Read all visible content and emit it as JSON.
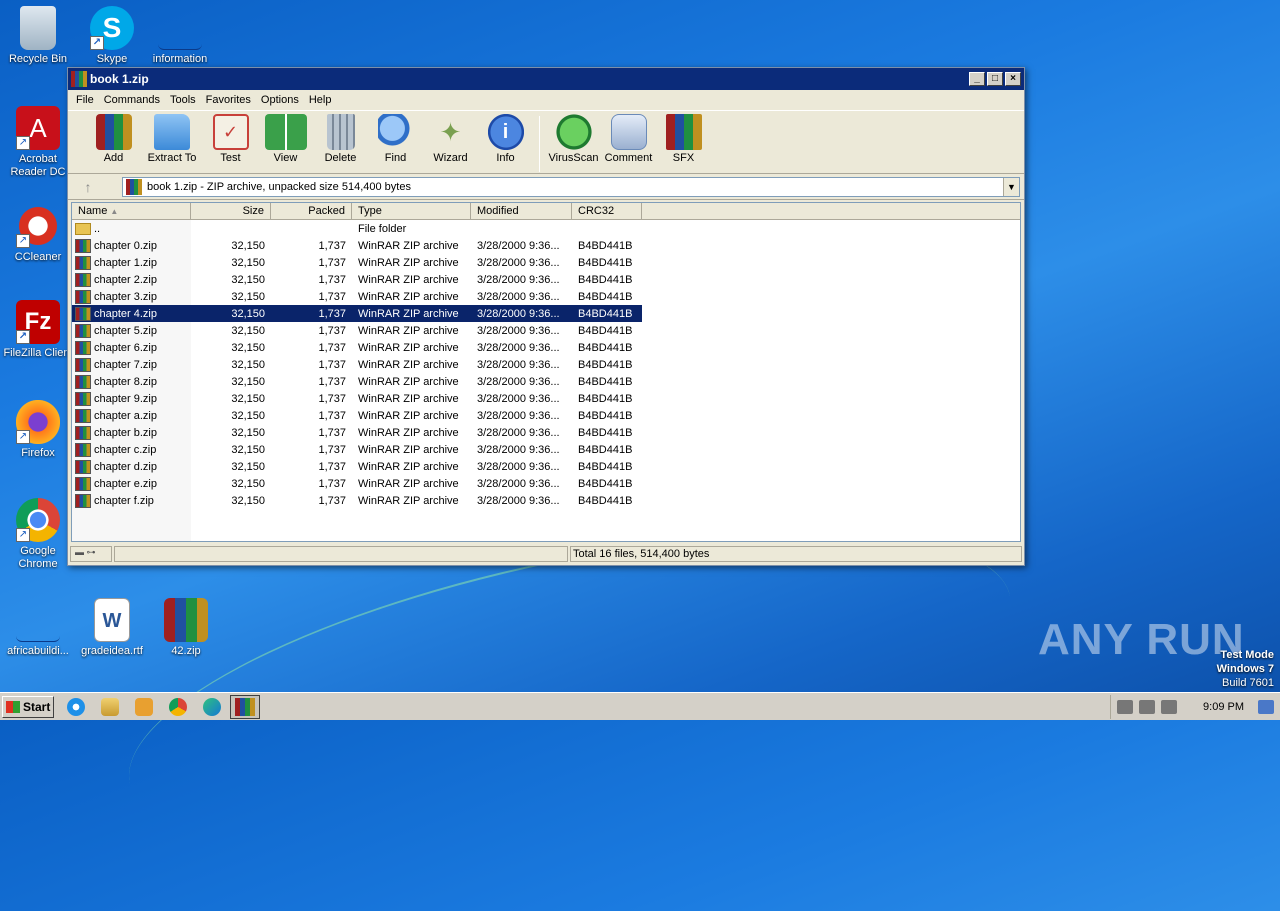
{
  "desktop": {
    "icons": [
      {
        "label": "Recycle Bin",
        "icon": "recycle-bin-icon"
      },
      {
        "label": "Skype",
        "icon": "skype-icon"
      },
      {
        "label": "information",
        "icon": "document-icon"
      },
      {
        "label": "Acrobat Reader DC",
        "icon": "acrobat-icon"
      },
      {
        "label": "CCleaner",
        "icon": "ccleaner-icon"
      },
      {
        "label": "FileZilla Client",
        "icon": "filezilla-icon"
      },
      {
        "label": "Firefox",
        "icon": "firefox-icon"
      },
      {
        "label": "Google Chrome",
        "icon": "chrome-icon"
      },
      {
        "label": "africabuildi...",
        "icon": "document-icon"
      },
      {
        "label": "gradeidea.rtf",
        "icon": "word-icon"
      },
      {
        "label": "42.zip",
        "icon": "winrar-icon"
      }
    ],
    "watermark": "ANY RUN",
    "test_mode": {
      "line1": "Test Mode",
      "line2": "Windows 7",
      "line3": "Build 7601"
    }
  },
  "window": {
    "title": "book 1.zip",
    "menu": [
      "File",
      "Commands",
      "Tools",
      "Favorites",
      "Options",
      "Help"
    ],
    "toolbar": [
      {
        "label": "Add",
        "icon": "add-icon",
        "color": "#b83a20"
      },
      {
        "label": "Extract To",
        "icon": "extract-folder-icon",
        "color": "#3c8ad8"
      },
      {
        "label": "Test",
        "icon": "test-checklist-icon",
        "color": "#c8403a"
      },
      {
        "label": "View",
        "icon": "view-book-icon",
        "color": "#3aa04a"
      },
      {
        "label": "Delete",
        "icon": "trash-icon",
        "color": "#8a98a8"
      },
      {
        "label": "Find",
        "icon": "magnifier-icon",
        "color": "#2f6fc8"
      },
      {
        "label": "Wizard",
        "icon": "wand-icon",
        "color": "#7aa050"
      },
      {
        "label": "Info",
        "icon": "info-icon",
        "color": "#2d62c8"
      },
      {
        "label": "VirusScan",
        "icon": "virus-scan-icon",
        "color": "#2ea040"
      },
      {
        "label": "Comment",
        "icon": "comment-icon",
        "color": "#6a8ab8"
      },
      {
        "label": "SFX",
        "icon": "sfx-box-icon",
        "color": "#c85a30"
      }
    ],
    "address": "book 1.zip - ZIP archive, unpacked size 514,400 bytes",
    "columns": [
      "Name",
      "Size",
      "Packed",
      "Type",
      "Modified",
      "CRC32"
    ],
    "parent_row": {
      "name": "..",
      "type": "File folder"
    },
    "files": [
      {
        "name": "chapter 0.zip",
        "size": "32,150",
        "packed": "1,737",
        "type": "WinRAR ZIP archive",
        "modified": "3/28/2000 9:36...",
        "crc": "B4BD441B"
      },
      {
        "name": "chapter 1.zip",
        "size": "32,150",
        "packed": "1,737",
        "type": "WinRAR ZIP archive",
        "modified": "3/28/2000 9:36...",
        "crc": "B4BD441B"
      },
      {
        "name": "chapter 2.zip",
        "size": "32,150",
        "packed": "1,737",
        "type": "WinRAR ZIP archive",
        "modified": "3/28/2000 9:36...",
        "crc": "B4BD441B"
      },
      {
        "name": "chapter 3.zip",
        "size": "32,150",
        "packed": "1,737",
        "type": "WinRAR ZIP archive",
        "modified": "3/28/2000 9:36...",
        "crc": "B4BD441B"
      },
      {
        "name": "chapter 4.zip",
        "size": "32,150",
        "packed": "1,737",
        "type": "WinRAR ZIP archive",
        "modified": "3/28/2000 9:36...",
        "crc": "B4BD441B",
        "selected": true
      },
      {
        "name": "chapter 5.zip",
        "size": "32,150",
        "packed": "1,737",
        "type": "WinRAR ZIP archive",
        "modified": "3/28/2000 9:36...",
        "crc": "B4BD441B"
      },
      {
        "name": "chapter 6.zip",
        "size": "32,150",
        "packed": "1,737",
        "type": "WinRAR ZIP archive",
        "modified": "3/28/2000 9:36...",
        "crc": "B4BD441B"
      },
      {
        "name": "chapter 7.zip",
        "size": "32,150",
        "packed": "1,737",
        "type": "WinRAR ZIP archive",
        "modified": "3/28/2000 9:36...",
        "crc": "B4BD441B"
      },
      {
        "name": "chapter 8.zip",
        "size": "32,150",
        "packed": "1,737",
        "type": "WinRAR ZIP archive",
        "modified": "3/28/2000 9:36...",
        "crc": "B4BD441B"
      },
      {
        "name": "chapter 9.zip",
        "size": "32,150",
        "packed": "1,737",
        "type": "WinRAR ZIP archive",
        "modified": "3/28/2000 9:36...",
        "crc": "B4BD441B"
      },
      {
        "name": "chapter a.zip",
        "size": "32,150",
        "packed": "1,737",
        "type": "WinRAR ZIP archive",
        "modified": "3/28/2000 9:36...",
        "crc": "B4BD441B"
      },
      {
        "name": "chapter b.zip",
        "size": "32,150",
        "packed": "1,737",
        "type": "WinRAR ZIP archive",
        "modified": "3/28/2000 9:36...",
        "crc": "B4BD441B"
      },
      {
        "name": "chapter c.zip",
        "size": "32,150",
        "packed": "1,737",
        "type": "WinRAR ZIP archive",
        "modified": "3/28/2000 9:36...",
        "crc": "B4BD441B"
      },
      {
        "name": "chapter d.zip",
        "size": "32,150",
        "packed": "1,737",
        "type": "WinRAR ZIP archive",
        "modified": "3/28/2000 9:36...",
        "crc": "B4BD441B"
      },
      {
        "name": "chapter e.zip",
        "size": "32,150",
        "packed": "1,737",
        "type": "WinRAR ZIP archive",
        "modified": "3/28/2000 9:36...",
        "crc": "B4BD441B"
      },
      {
        "name": "chapter f.zip",
        "size": "32,150",
        "packed": "1,737",
        "type": "WinRAR ZIP archive",
        "modified": "3/28/2000 9:36...",
        "crc": "B4BD441B"
      }
    ],
    "status": "Total 16 files, 514,400 bytes"
  },
  "taskbar": {
    "start_label": "Start",
    "clock": "9:09 PM",
    "quick_launch": [
      "ie-icon",
      "explorer-icon",
      "media-player-icon",
      "chrome-icon",
      "edge-icon"
    ],
    "active_task": "winrar-icon"
  }
}
